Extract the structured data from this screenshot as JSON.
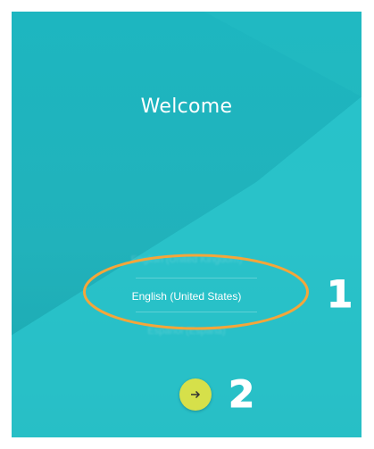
{
  "screen": {
    "title": "Welcome"
  },
  "language_picker": {
    "previous": "English (United Kingdom)",
    "selected": "English (United States)",
    "next": "Español (España)"
  },
  "next_button": {
    "icon": "arrow-right-icon",
    "color": "#d6e04a"
  },
  "annotations": {
    "marker_1": "1",
    "marker_2": "2",
    "highlight_color": "#f4a63a"
  },
  "colors": {
    "background": "#1db6c0"
  }
}
